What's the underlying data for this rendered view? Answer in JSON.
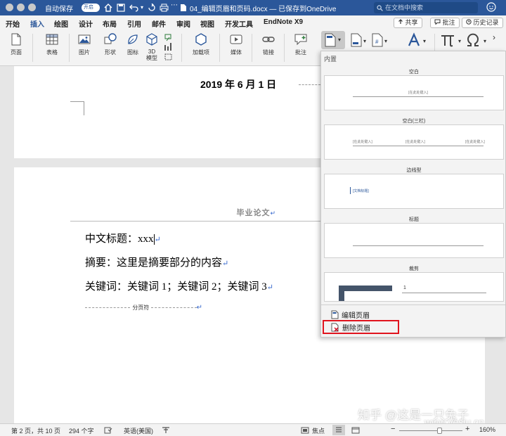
{
  "titlebar": {
    "autosave_label": "自动保存",
    "autosave_state": "开启",
    "doc_title": "04_编辑页眉和页码.docx — 已保存到OneDrive",
    "search_placeholder": "在文档中搜索"
  },
  "tabs": [
    "开始",
    "插入",
    "绘图",
    "设计",
    "布局",
    "引用",
    "邮件",
    "审阅",
    "视图",
    "开发工具",
    "EndNote X9"
  ],
  "active_tab": "插入",
  "tab_buttons": {
    "share": "共享",
    "comment": "批注",
    "history": "历史记录"
  },
  "ribbon": {
    "page": "页面",
    "table": "表格",
    "picture": "图片",
    "shapes": "形状",
    "icons": "图标",
    "model3d_line1": "3D",
    "model3d_line2": "模型",
    "addins": "加载项",
    "media": "媒体",
    "link": "链接",
    "comment": "批注"
  },
  "document": {
    "date_line": "2019 年 6 月 1 日",
    "header_text": "毕业论文",
    "title_line": "中文标题：xxx",
    "abstract_line": "摘要：这里是摘要部分的内容",
    "keywords_line": "关键词：关键词 1；关键词 2；关键词 3",
    "page_break_label": "分页符"
  },
  "header_panel": {
    "section_title": "内置",
    "templates": [
      {
        "name": "空白",
        "placeholder": "[在此处键入]"
      },
      {
        "name": "空白(三栏)",
        "placeholder": "[在此处键入]"
      },
      {
        "name": "边线型",
        "placeholder": "[文档标题]"
      },
      {
        "name": "标题",
        "placeholder": ""
      },
      {
        "name": "裁剪",
        "placeholder": "1"
      }
    ],
    "menu": {
      "edit_header": "编辑页眉",
      "delete_header": "删除页眉"
    }
  },
  "status": {
    "page_info": "第 2 页，共 10 页",
    "word_count": "294 个字",
    "language": "英语(美国)",
    "focus": "焦点",
    "zoom": "160%"
  },
  "watermarks": {
    "zhihu": "知乎 @这是一只兔子",
    "site": "www.yesiu.cn"
  },
  "colors": {
    "word_blue": "#2b579a",
    "highlight_red": "#e0141e"
  }
}
